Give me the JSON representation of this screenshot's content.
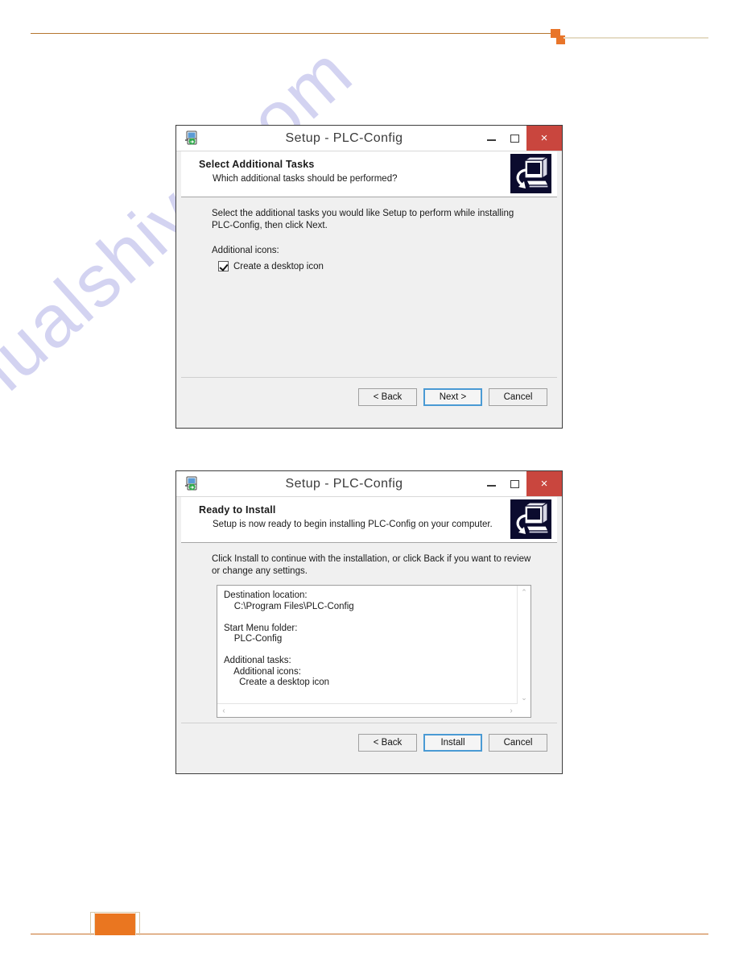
{
  "page": {
    "watermark": "manualshive.com",
    "accent_orange": "#e8752a",
    "accent_rule": "#b5762f"
  },
  "dialogs": [
    {
      "id": "select-additional-tasks",
      "window_title": "Setup - PLC-Config",
      "title_icon": "installer-icon",
      "window_buttons": {
        "minimize": "–",
        "maximize": "□",
        "close": "×",
        "close_color": "#c9463e"
      },
      "header": {
        "title": "Select Additional Tasks",
        "subtitle": "Which additional tasks should be performed?",
        "icon": "computer-install-icon"
      },
      "body": {
        "paragraph": "Select the additional tasks you would like Setup to perform while installing PLC-Config, then click Next.",
        "group_label": "Additional icons:",
        "checkbox_label": "Create a desktop icon",
        "checkbox_checked": true
      },
      "buttons": {
        "back": "< Back",
        "next": "Next >",
        "cancel": "Cancel",
        "default": "Next >"
      }
    },
    {
      "id": "ready-to-install",
      "window_title": "Setup - PLC-Config",
      "title_icon": "installer-icon",
      "window_buttons": {
        "minimize": "–",
        "maximize": "□",
        "close": "×",
        "close_color": "#c9463e"
      },
      "header": {
        "title": "Ready to Install",
        "subtitle": "Setup is now ready to begin installing PLC-Config on your computer.",
        "icon": "computer-install-icon"
      },
      "body": {
        "paragraph": "Click Install to continue with the installation, or click Back if you want to review or change any settings.",
        "summary": "Destination location:\n    C:\\Program Files\\PLC-Config\n\nStart Menu folder:\n    PLC-Config\n\nAdditional tasks:\n    Additional icons:\n      Create a desktop icon",
        "scroll_up": "⌃",
        "scroll_down": "⌄",
        "scroll_left": "‹",
        "scroll_right": "›"
      },
      "buttons": {
        "back": "< Back",
        "install": "Install",
        "cancel": "Cancel",
        "default": "Install"
      }
    }
  ]
}
